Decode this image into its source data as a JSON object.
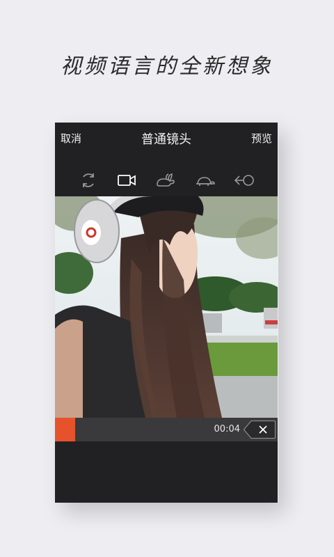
{
  "banner": {
    "tagline": "视频语言的全新想象"
  },
  "header": {
    "cancel_label": "取消",
    "title": "普通镜头",
    "preview_label": "预览"
  },
  "mode_toolbar": {
    "modes": [
      {
        "icon": "loop-icon",
        "active": false
      },
      {
        "icon": "video-camera-icon",
        "active": true
      },
      {
        "icon": "rabbit-icon",
        "active": false
      },
      {
        "icon": "turtle-icon",
        "active": false
      },
      {
        "icon": "reverse-icon",
        "active": false
      }
    ]
  },
  "timeline": {
    "time": "00:04",
    "progress_percent": 9,
    "progress_color": "#e6522c"
  },
  "colors": {
    "page_background": "#eeeef2",
    "panel_background": "#212123",
    "accent": "#e6522c"
  }
}
